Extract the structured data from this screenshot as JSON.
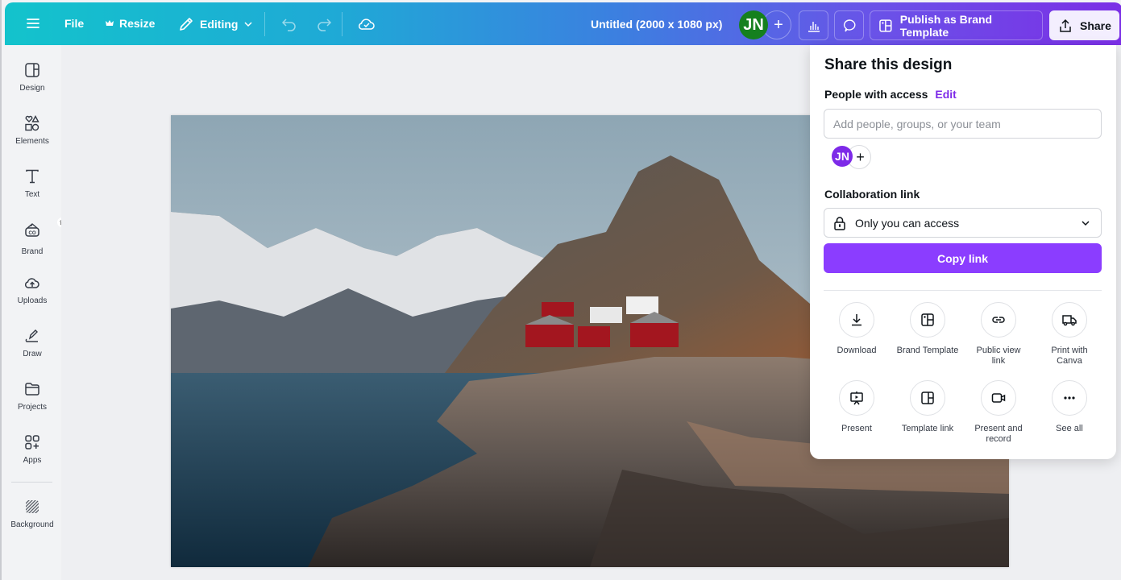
{
  "topbar": {
    "menu_icon": "hamburger-icon",
    "file_label": "File",
    "resize_label": "Resize",
    "editing_label": "Editing",
    "document_title": "Untitled (2000 x 1080 px)",
    "user_initials": "JN",
    "user_avatar_color": "#15801e",
    "publish_label": "Publish as Brand Template",
    "share_label": "Share"
  },
  "sidebar": {
    "items": [
      {
        "label": "Design",
        "icon": "design-layout-icon"
      },
      {
        "label": "Elements",
        "icon": "elements-shapes-icon"
      },
      {
        "label": "Text",
        "icon": "text-icon"
      },
      {
        "label": "Brand",
        "icon": "brand-kit-icon"
      },
      {
        "label": "Uploads",
        "icon": "cloud-upload-icon"
      },
      {
        "label": "Draw",
        "icon": "draw-pen-icon"
      },
      {
        "label": "Projects",
        "icon": "folder-icon"
      },
      {
        "label": "Apps",
        "icon": "apps-grid-icon"
      },
      {
        "label": "Background",
        "icon": "background-hatch-icon"
      }
    ]
  },
  "canvas": {
    "image_description": "Fjord with snowy mountains, rocky shore and red cabins"
  },
  "share_panel": {
    "title": "Share this design",
    "people_label": "People with access",
    "edit_label": "Edit",
    "search_placeholder": "Add people, groups, or your team",
    "search_value": "",
    "member_initials": "JN",
    "member_color": "#7d2ae8",
    "collab_label": "Collaboration link",
    "access_option": "Only you can access",
    "copy_label": "Copy link",
    "accent_color": "#8b3dff",
    "actions": [
      {
        "label": "Download",
        "icon": "download-icon"
      },
      {
        "label": "Brand Template",
        "icon": "brand-template-icon"
      },
      {
        "label": "Public view link",
        "icon": "link-icon"
      },
      {
        "label": "Print with Canva",
        "icon": "truck-icon"
      },
      {
        "label": "Present",
        "icon": "present-icon"
      },
      {
        "label": "Template link",
        "icon": "template-link-icon"
      },
      {
        "label": "Present and record",
        "icon": "video-camera-icon"
      },
      {
        "label": "See all",
        "icon": "more-dots-icon"
      }
    ]
  }
}
